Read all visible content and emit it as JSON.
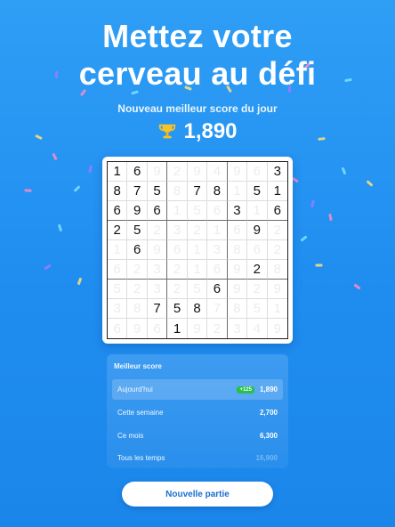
{
  "headline": {
    "line1": "Mettez votre",
    "line2": "cerveau au défi"
  },
  "subtitle": "Nouveau meilleur score du jour",
  "score": {
    "icon": "trophy-icon",
    "value": "1,890"
  },
  "board": {
    "rows": [
      [
        "1",
        "6",
        "9",
        "2",
        "9",
        "4",
        "9",
        "6",
        "3"
      ],
      [
        "8",
        "7",
        "5",
        "8",
        "7",
        "8",
        "1",
        "5",
        "1"
      ],
      [
        "6",
        "9",
        "6",
        "1",
        "5",
        "6",
        "3",
        "1",
        "6"
      ],
      [
        "2",
        "5",
        "2",
        "3",
        "2",
        "1",
        "6",
        "9",
        "2"
      ],
      [
        "1",
        "6",
        "9",
        "6",
        "1",
        "3",
        "8",
        "6",
        "2"
      ],
      [
        "6",
        "2",
        "3",
        "2",
        "1",
        "6",
        "9",
        "2",
        "8"
      ],
      [
        "5",
        "2",
        "3",
        "2",
        "5",
        "6",
        "9",
        "2",
        "9"
      ],
      [
        "3",
        "8",
        "7",
        "5",
        "8",
        "7",
        "8",
        "5",
        "1"
      ],
      [
        "6",
        "9",
        "6",
        "1",
        "9",
        "2",
        "3",
        "4",
        "9"
      ]
    ],
    "given": [
      [
        1,
        1,
        0,
        0,
        0,
        0,
        0,
        0,
        1
      ],
      [
        1,
        1,
        1,
        0,
        1,
        1,
        0,
        1,
        1
      ],
      [
        1,
        1,
        1,
        0,
        0,
        0,
        1,
        0,
        1
      ],
      [
        1,
        1,
        0,
        0,
        0,
        0,
        0,
        1,
        0
      ],
      [
        0,
        1,
        0,
        0,
        0,
        0,
        0,
        0,
        0
      ],
      [
        0,
        0,
        0,
        0,
        0,
        0,
        0,
        1,
        0
      ],
      [
        0,
        0,
        0,
        0,
        0,
        1,
        0,
        0,
        0
      ],
      [
        0,
        0,
        1,
        1,
        1,
        0,
        0,
        0,
        0
      ],
      [
        0,
        0,
        0,
        1,
        0,
        0,
        0,
        0,
        0
      ]
    ]
  },
  "stats": {
    "title": "Meilleur score",
    "rows": [
      {
        "label": "Aujourd'hui",
        "value": "1,890",
        "badge": "+125"
      },
      {
        "label": "Cette semaine",
        "value": "2,700"
      },
      {
        "label": "Ce mois",
        "value": "6,300"
      },
      {
        "label": "Tous les temps",
        "value": "16,900"
      }
    ]
  },
  "button": {
    "label": "Nouvelle partie"
  },
  "colors": {
    "background": "#2196f3",
    "badge": "#26c04a",
    "button_text": "#1a6fd0"
  }
}
